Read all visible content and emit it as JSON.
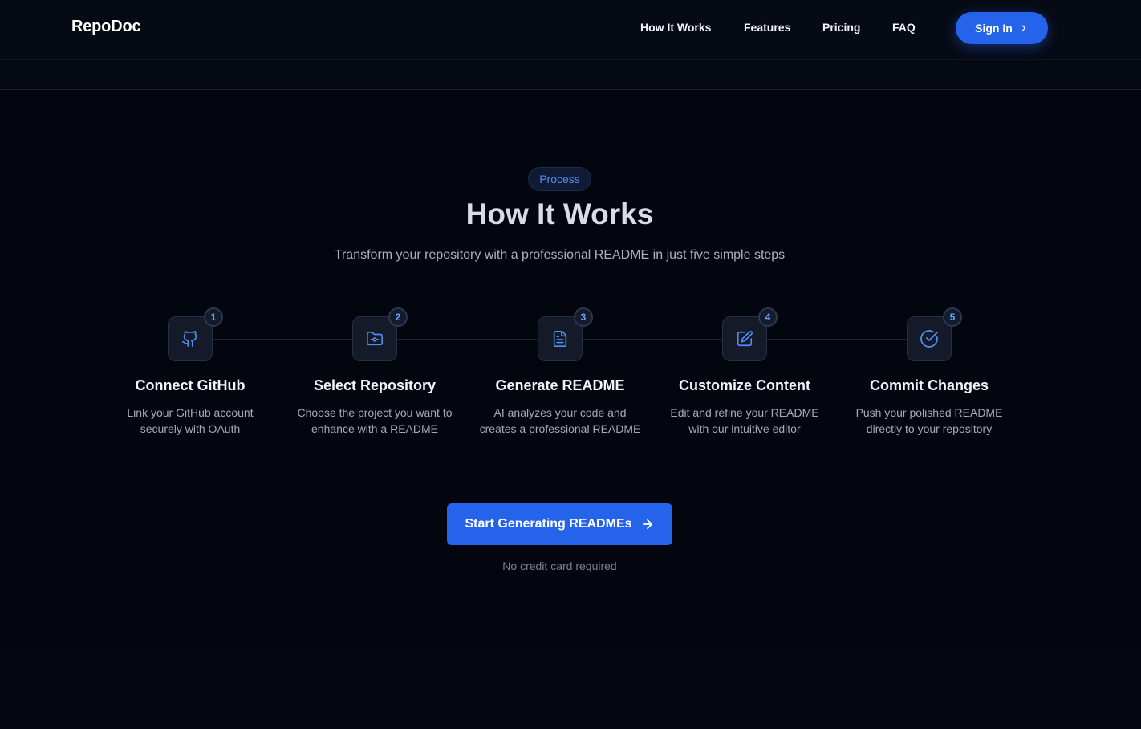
{
  "brand": "RepoDoc",
  "nav": {
    "links": [
      "How It Works",
      "Features",
      "Pricing",
      "FAQ"
    ],
    "signin_label": "Sign In"
  },
  "section": {
    "badge": "Process",
    "title": "How It Works",
    "subtitle": "Transform your repository with a professional README in just five simple steps",
    "steps": [
      {
        "number": "1",
        "icon": "github-icon",
        "title": "Connect GitHub",
        "description": "Link your GitHub account securely with OAuth"
      },
      {
        "number": "2",
        "icon": "folder-git-icon",
        "title": "Select Repository",
        "description": "Choose the project you want to enhance with a README"
      },
      {
        "number": "3",
        "icon": "file-text-icon",
        "title": "Generate README",
        "description": "AI analyzes your code and creates a professional README"
      },
      {
        "number": "4",
        "icon": "edit-icon",
        "title": "Customize Content",
        "description": "Edit and refine your README with our intuitive editor"
      },
      {
        "number": "5",
        "icon": "check-circle-icon",
        "title": "Commit Changes",
        "description": "Push your polished README directly to your repository"
      }
    ],
    "cta_label": "Start Generating READMEs",
    "cta_note": "No credit card required"
  },
  "colors": {
    "accent": "#2563eb",
    "icon": "#4f8df6",
    "background": "#03060f"
  }
}
